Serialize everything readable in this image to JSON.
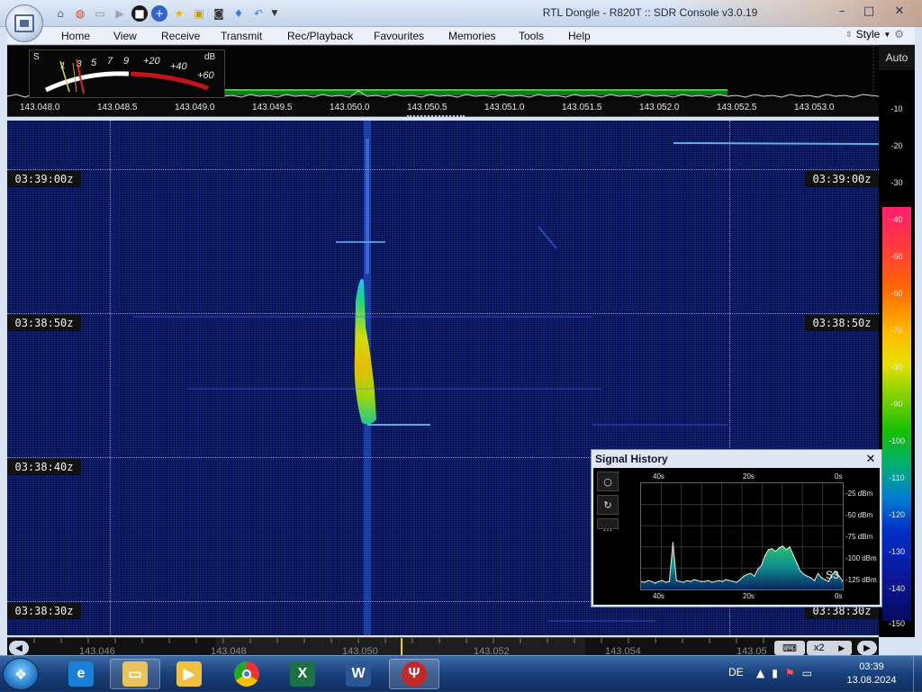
{
  "window": {
    "title": "RTL Dongle - R820T :: SDR Console v3.0.19",
    "controls": {
      "minimize": "–",
      "maximize": "□",
      "close": "✕"
    }
  },
  "quick_access": [
    "home-icon",
    "lifebuoy-icon",
    "folder-icon",
    "play-icon",
    "stop-icon",
    "add-icon",
    "star-icon",
    "lock-icon",
    "camera-icon",
    "drop-icon",
    "undo-icon",
    "dropdown-icon"
  ],
  "menu": {
    "items": [
      "Home",
      "View",
      "Receive",
      "Transmit",
      "Rec/Playback",
      "Favourites",
      "Memories",
      "Tools",
      "Help"
    ],
    "style_label": "Style"
  },
  "smeter": {
    "s_label": "S",
    "scale": [
      "1",
      "3",
      "5",
      "7",
      "9"
    ],
    "plus_scale": [
      "+20",
      "+40",
      "+60"
    ],
    "unit": "dB"
  },
  "auto_label": "Auto",
  "freq_axis": [
    "143.048.0",
    "143.048.5",
    "143.049.0",
    "143.049.5",
    "143.050.0",
    "143.050.5",
    "143.051.0",
    "143.051.5",
    "143.052.0",
    "143.052.5",
    "143.053.0"
  ],
  "timestamps": [
    "03:39:00z",
    "03:38:50z",
    "03:38:40z",
    "03:38:30z"
  ],
  "color_scale": [
    "-10",
    "-20",
    "-30",
    "-40",
    "-50",
    "-60",
    "-70",
    "-80",
    "-90",
    "-100",
    "-110",
    "-120",
    "-130",
    "-140",
    "-150"
  ],
  "band_labels": [
    "143.046",
    "143.048",
    "143.050",
    "143.052",
    "143.054",
    "143.05"
  ],
  "zoom": {
    "label": "x2"
  },
  "signal_history": {
    "title": "Signal History",
    "close": "✕",
    "tools": [
      "○",
      "↻",
      "···"
    ],
    "x_labels": [
      "40s",
      "20s",
      "0s"
    ],
    "y_labels": [
      "-25 dBm",
      "-50 dBm",
      "-75 dBm",
      "-100 dBm",
      "-125 dBm"
    ],
    "s_reading": "S3",
    "chart_data": {
      "type": "area",
      "x_range": [
        "40s",
        "0s"
      ],
      "ylim": [
        -135,
        -15
      ],
      "series": [
        {
          "values": [
            -126,
            -127,
            -125,
            -126,
            -128,
            -126,
            -125,
            -127,
            -126,
            -82,
            -125,
            -126,
            -127,
            -125,
            -126,
            -124,
            -125,
            -126,
            -126,
            -125,
            -127,
            -126,
            -125,
            -126,
            -124,
            -125,
            -126,
            -127,
            -124,
            -120,
            -118,
            -117,
            -120,
            -112,
            -108,
            -97,
            -90,
            -89,
            -92,
            -88,
            -86,
            -90,
            -87,
            -96,
            -105,
            -114,
            -118,
            -120,
            -122,
            -125,
            -117,
            -122,
            -124,
            -126,
            -118,
            -115,
            -120,
            -126
          ]
        }
      ]
    }
  },
  "taskbar": {
    "apps": [
      "explorer-icon",
      "ie-icon",
      "folder-icon",
      "media-icon",
      "chrome-icon",
      "excel-icon",
      "word-icon",
      "sdr-icon"
    ],
    "language": "DE",
    "time": "03:39",
    "date": "13.08.2024"
  }
}
